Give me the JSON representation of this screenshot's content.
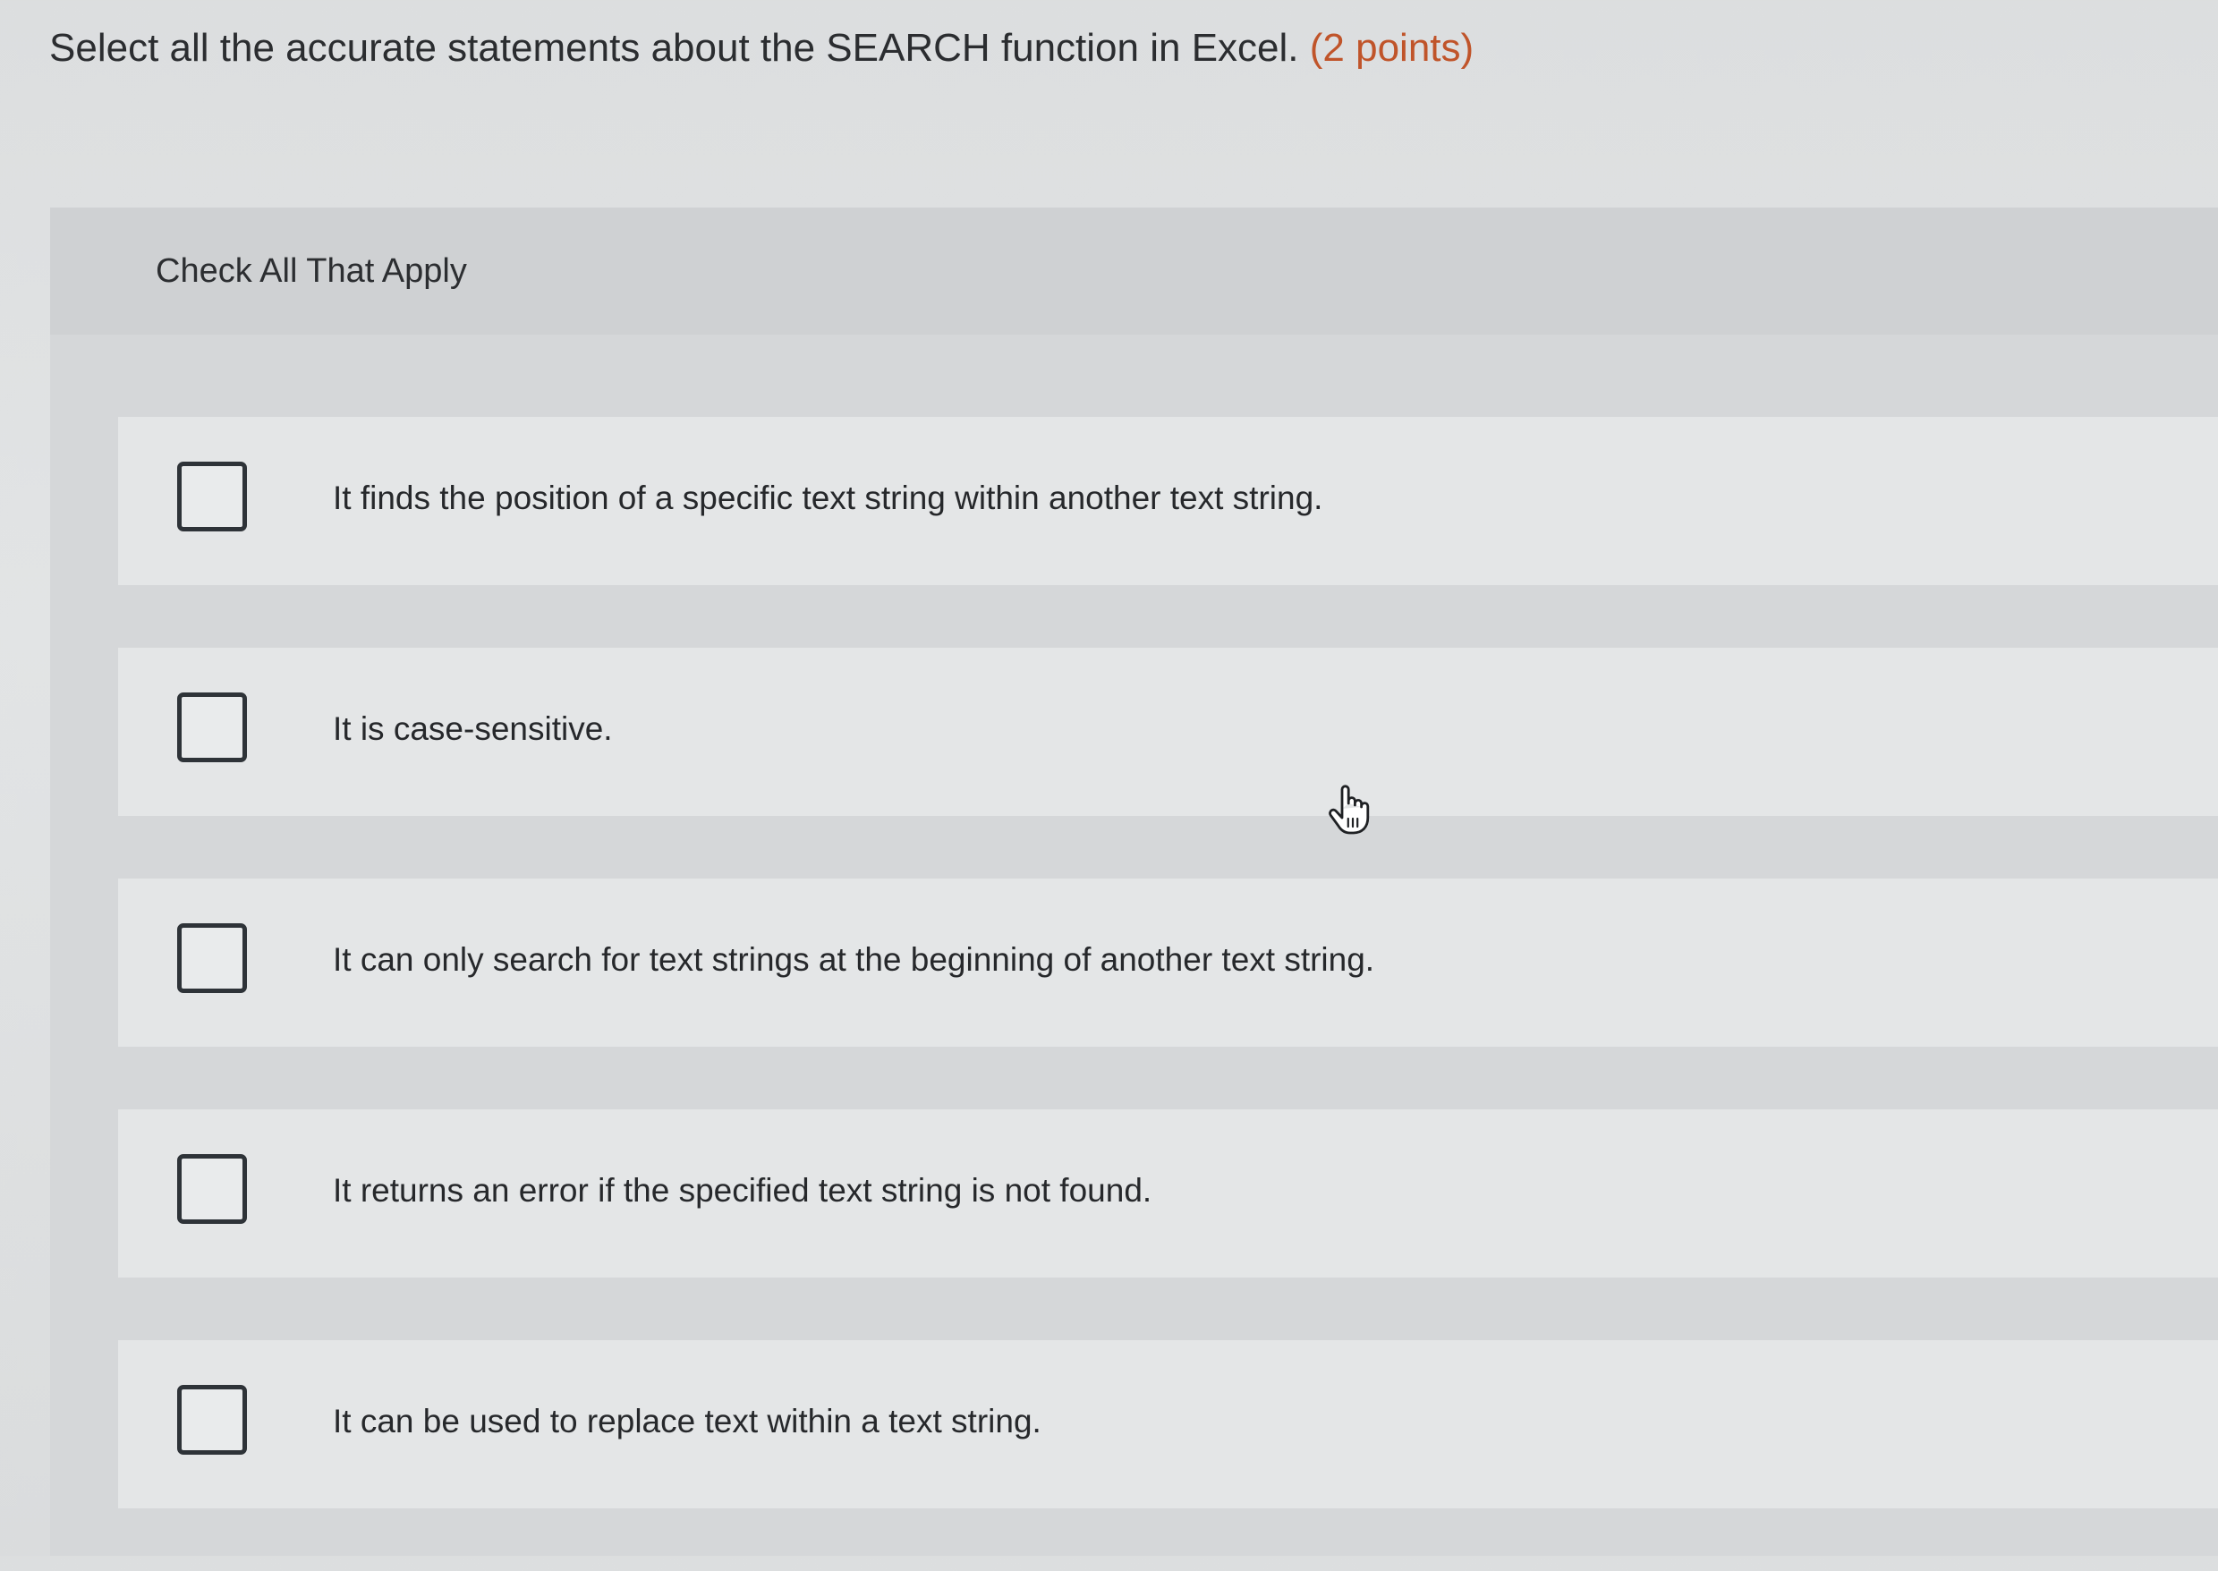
{
  "question": {
    "text": "Select all the accurate statements about the SEARCH function in Excel.",
    "points": "(2 points)"
  },
  "panel": {
    "title": "Check All That Apply",
    "options": [
      {
        "label": "It finds the position of a specific text string within another text string.",
        "checked": false
      },
      {
        "label": "It is case-sensitive.",
        "checked": false
      },
      {
        "label": "It can only search for text strings at the beginning of another text string.",
        "checked": false
      },
      {
        "label": "It returns an error if the specified text string is not found.",
        "checked": false
      },
      {
        "label": "It can be used to replace text within a text string.",
        "checked": false
      }
    ]
  },
  "icons": {
    "checkbox": "checkbox-unchecked-icon",
    "cursor": "hand-pointer-cursor-icon"
  },
  "colors": {
    "points": "#c0542a",
    "checkbox_border": "#2e3338"
  }
}
